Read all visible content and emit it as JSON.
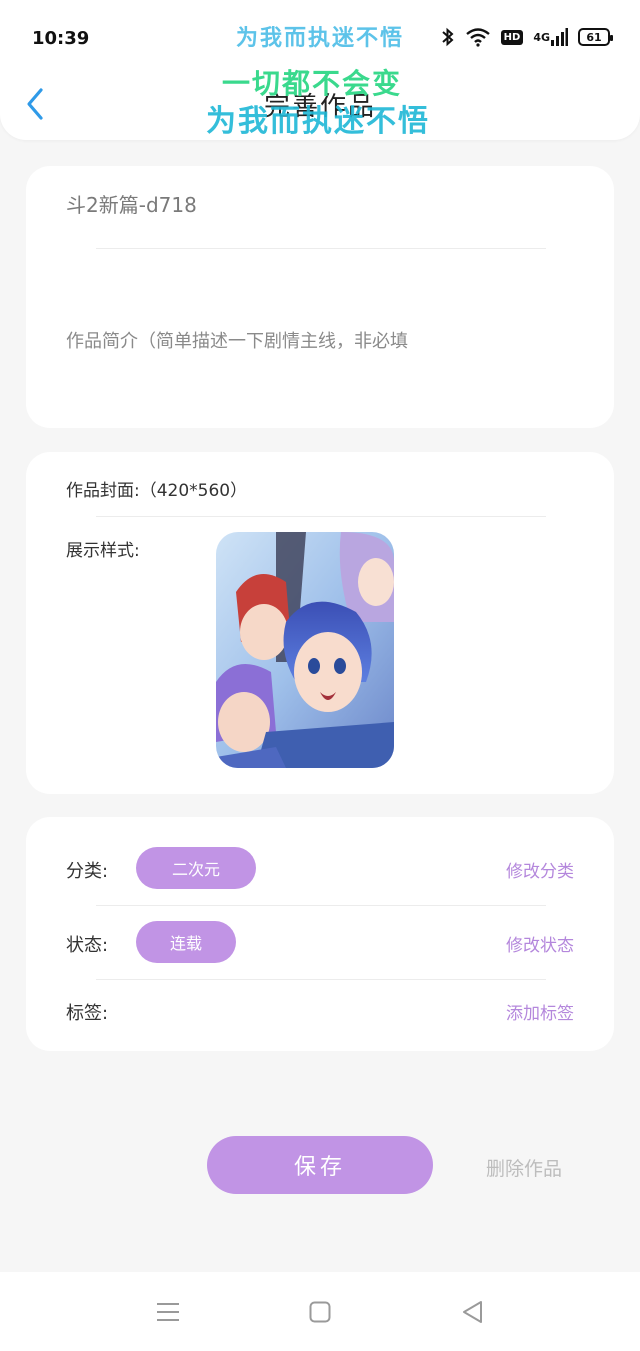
{
  "status_bar": {
    "time": "10:39",
    "network": "4G",
    "hd": "HD",
    "battery": "61",
    "icons": [
      "bluetooth-icon",
      "wifi-icon",
      "hd-icon",
      "signal-icon",
      "battery-icon"
    ]
  },
  "header": {
    "title": "完善作品",
    "back_icon": "chevron-left-icon"
  },
  "watermark": {
    "line1": "为我而执迷不悟",
    "line2": "一切都不会变",
    "line3": "为我而执迷不悟"
  },
  "work": {
    "title_value": "斗2新篇-d718",
    "intro_placeholder": "作品简介（简单描述一下剧情主线，非必填"
  },
  "cover": {
    "label": "作品封面:（420*560）",
    "style_label": "展示样式:"
  },
  "meta": {
    "category_label": "分类:",
    "category_value": "二次元",
    "category_action": "修改分类",
    "status_label": "状态:",
    "status_value": "连载",
    "status_action": "修改状态",
    "tags_label": "标签:",
    "tags_action": "添加标签"
  },
  "actions": {
    "save": "保存",
    "delete": "删除作品"
  },
  "nav": {
    "icons": [
      "menu-icon",
      "home-square-icon",
      "back-triangle-icon"
    ]
  },
  "colors": {
    "accent": "#c194e5",
    "accent_text": "#b487dc",
    "back_arrow": "#2f9ae8",
    "background": "#f6f6f6"
  }
}
